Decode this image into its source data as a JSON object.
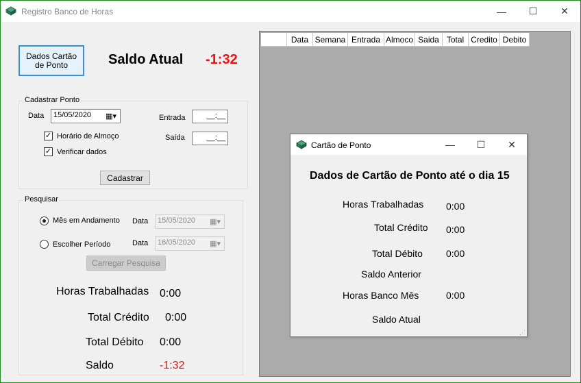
{
  "window": {
    "title": "Registro Banco de Horas",
    "minimize": "—",
    "maximize": "☐",
    "close": "✕"
  },
  "main": {
    "dados_button": "Dados Cartão de Ponto",
    "saldo_label": "Saldo Atual",
    "saldo_value": "-1:32",
    "saldo_color": "#ee1111"
  },
  "cadastrar": {
    "title": "Cadastrar Ponto",
    "data_label": "Data",
    "data_value": "15/05/2020",
    "entrada_label": "Entrada",
    "entrada_value": "__:__",
    "saida_label": "Saída",
    "saida_value": "__:__",
    "almoco_label": "Horário de Almoço",
    "almoco_checked": true,
    "verificar_label": "Verificar dados",
    "verificar_checked": true,
    "button": "Cadastrar"
  },
  "pesquisar": {
    "title": "Pesquisar",
    "mes_label": "Mês em Andamento",
    "mes_selected": true,
    "mes_data_label": "Data",
    "mes_data_value": "15/05/2020",
    "periodo_label": "Escolher Período",
    "periodo_data_label": "Data",
    "periodo_data_value": "16/05/2020",
    "button": "Carregar Pesquisa"
  },
  "summary": {
    "horas_label": "Horas Trabalhadas",
    "horas_value": "0:00",
    "credito_label": "Total Crédito",
    "credito_value": "0:00",
    "debito_label": "Total Débito",
    "debito_value": "0:00",
    "saldo_label": "Saldo",
    "saldo_value": "-1:32"
  },
  "grid": {
    "columns": [
      "",
      "Data",
      "Semana",
      "Entrada",
      "Almoco",
      "Saida",
      "Total",
      "Credito",
      "Debito"
    ]
  },
  "dialog": {
    "title": "Cartão de Ponto",
    "minimize": "—",
    "maximize": "☐",
    "close": "✕",
    "heading": "Dados de Cartão de Ponto até o dia 15",
    "horas_label": "Horas Trabalhadas",
    "horas_value": "0:00",
    "credito_label": "Total Crédito",
    "credito_value": "0:00",
    "debito_label": "Total Débito",
    "debito_value": "0:00",
    "anterior_label": "Saldo Anterior",
    "banco_label": "Horas Banco Mês",
    "banco_value": "0:00",
    "atual_label": "Saldo Atual"
  }
}
